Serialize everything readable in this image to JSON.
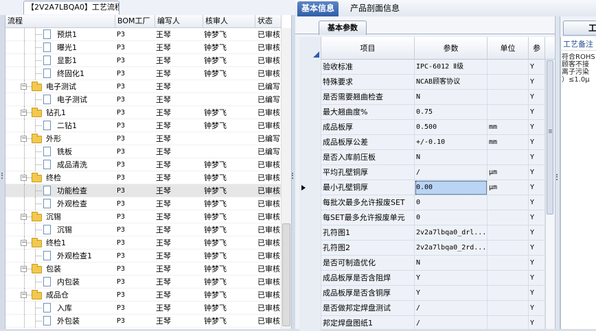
{
  "left_panel": {
    "tab_label": "【2V2A7LBQA0】工艺流程",
    "columns": [
      "流程",
      "BOM工厂",
      "编写人",
      "核审人",
      "状态"
    ],
    "rows": [
      {
        "level": 1,
        "type": "doc",
        "name": "预烘1",
        "bom": "P3",
        "author": "王琴",
        "reviewer": "钟梦飞",
        "status": "已审核"
      },
      {
        "level": 1,
        "type": "doc",
        "name": "曝光1",
        "bom": "P3",
        "author": "王琴",
        "reviewer": "钟梦飞",
        "status": "已审核"
      },
      {
        "level": 1,
        "type": "doc",
        "name": "显影1",
        "bom": "P3",
        "author": "王琴",
        "reviewer": "钟梦飞",
        "status": "已审核"
      },
      {
        "level": 1,
        "type": "doc",
        "name": "终固化1",
        "bom": "P3",
        "author": "王琴",
        "reviewer": "钟梦飞",
        "status": "已审核"
      },
      {
        "level": 0,
        "type": "folder",
        "name": "电子测试",
        "bom": "P3",
        "author": "王琴",
        "reviewer": "",
        "status": "已编写"
      },
      {
        "level": 1,
        "type": "doc",
        "name": "电子测试",
        "bom": "P3",
        "author": "王琴",
        "reviewer": "",
        "status": "已编写"
      },
      {
        "level": 0,
        "type": "folder",
        "name": "钻孔1",
        "bom": "P3",
        "author": "王琴",
        "reviewer": "钟梦飞",
        "status": "已审核"
      },
      {
        "level": 1,
        "type": "doc",
        "name": "二钻1",
        "bom": "P3",
        "author": "王琴",
        "reviewer": "钟梦飞",
        "status": "已审核"
      },
      {
        "level": 0,
        "type": "folder",
        "name": "外形",
        "bom": "P3",
        "author": "王琴",
        "reviewer": "",
        "status": "已编写"
      },
      {
        "level": 1,
        "type": "doc",
        "name": "铣板",
        "bom": "P3",
        "author": "王琴",
        "reviewer": "",
        "status": "已编写"
      },
      {
        "level": 1,
        "type": "doc",
        "name": "成品清洗",
        "bom": "P3",
        "author": "王琴",
        "reviewer": "钟梦飞",
        "status": "已审核"
      },
      {
        "level": 0,
        "type": "folder",
        "name": "终检",
        "bom": "P3",
        "author": "王琴",
        "reviewer": "钟梦飞",
        "status": "已审核"
      },
      {
        "level": 1,
        "type": "doc",
        "name": "功能检查",
        "bom": "P3",
        "author": "王琴",
        "reviewer": "钟梦飞",
        "status": "已审核",
        "selected": true
      },
      {
        "level": 1,
        "type": "doc",
        "name": "外观检查",
        "bom": "P3",
        "author": "王琴",
        "reviewer": "钟梦飞",
        "status": "已审核"
      },
      {
        "level": 0,
        "type": "folder",
        "name": "沉锡",
        "bom": "P3",
        "author": "王琴",
        "reviewer": "钟梦飞",
        "status": "已审核"
      },
      {
        "level": 1,
        "type": "doc",
        "name": "沉锡",
        "bom": "P3",
        "author": "王琴",
        "reviewer": "钟梦飞",
        "status": "已审核"
      },
      {
        "level": 0,
        "type": "folder",
        "name": "终检1",
        "bom": "P3",
        "author": "王琴",
        "reviewer": "钟梦飞",
        "status": "已审核"
      },
      {
        "level": 1,
        "type": "doc",
        "name": "外观检查1",
        "bom": "P3",
        "author": "王琴",
        "reviewer": "钟梦飞",
        "status": "已审核"
      },
      {
        "level": 0,
        "type": "folder",
        "name": "包装",
        "bom": "P3",
        "author": "王琴",
        "reviewer": "钟梦飞",
        "status": "已审核"
      },
      {
        "level": 1,
        "type": "doc",
        "name": "内包装",
        "bom": "P3",
        "author": "王琴",
        "reviewer": "钟梦飞",
        "status": "已审核"
      },
      {
        "level": 0,
        "type": "folder",
        "name": "成品仓",
        "bom": "P3",
        "author": "王琴",
        "reviewer": "钟梦飞",
        "status": "已审核"
      },
      {
        "level": 1,
        "type": "doc",
        "name": "入库",
        "bom": "P3",
        "author": "王琴",
        "reviewer": "钟梦飞",
        "status": "已审核"
      },
      {
        "level": 1,
        "type": "doc",
        "name": "外包装",
        "bom": "P3",
        "author": "王琴",
        "reviewer": "钟梦飞",
        "status": "已审核"
      }
    ]
  },
  "right_panel": {
    "tabs": [
      "基本信息",
      "产品剖面信息"
    ],
    "sub_tab": "基本参数",
    "columns": [
      "项目",
      "参数",
      "单位",
      "参"
    ],
    "rows": [
      {
        "item": "验收标准",
        "param": "IPC-6012 Ⅱ级",
        "unit": "",
        "flag": "Y"
      },
      {
        "item": "特殊要求",
        "param": "NCAB顾客协议",
        "unit": "",
        "flag": "Y"
      },
      {
        "item": "是否需要翘曲检查",
        "param": "N",
        "unit": "",
        "flag": "Y"
      },
      {
        "item": "最大翘曲度%",
        "param": "0.75",
        "unit": "",
        "flag": "Y"
      },
      {
        "item": "成品板厚",
        "param": "0.500",
        "unit": "mm",
        "flag": "Y"
      },
      {
        "item": "成品板厚公差",
        "param": "+/-0.10",
        "unit": "mm",
        "flag": "Y"
      },
      {
        "item": "是否入库前压板",
        "param": "N",
        "unit": "",
        "flag": "Y"
      },
      {
        "item": "平均孔壁铜厚",
        "param": "/",
        "unit": "μm",
        "flag": "Y"
      },
      {
        "item": "最小孔壁铜厚",
        "param": "0.00",
        "unit": "μm",
        "flag": "Y",
        "current": true
      },
      {
        "item": "每批次最多允许报废SET",
        "param": "0",
        "unit": "",
        "flag": "Y"
      },
      {
        "item": "每SET最多允许报废单元",
        "param": "0",
        "unit": "",
        "flag": "Y"
      },
      {
        "item": "孔符图1",
        "param": "2v2a7lbqa0_drl...",
        "unit": "",
        "flag": "Y"
      },
      {
        "item": "孔符图2",
        "param": "2v2a7lbqa0_2rd...",
        "unit": "",
        "flag": "Y"
      },
      {
        "item": "是否可制造优化",
        "param": "N",
        "unit": "",
        "flag": "Y"
      },
      {
        "item": "成品板厚是否含阻焊",
        "param": "Y",
        "unit": "",
        "flag": "Y"
      },
      {
        "item": "成品板厚是否含铜厚",
        "param": "Y",
        "unit": "",
        "flag": "Y"
      },
      {
        "item": "是否做邦定焊盘测试",
        "param": "/",
        "unit": "",
        "flag": "Y"
      },
      {
        "item": "邦定焊盘图纸1",
        "param": "/",
        "unit": "",
        "flag": "Y"
      }
    ],
    "side_tab": "工艺",
    "side_header": "工艺备注",
    "side_text": "符合ROHS\n顾客不接\n离子污染\n）≤1.0μ"
  },
  "colors": {
    "active_tab": "#2f5ea8",
    "selected_cell": "#b9d4f5",
    "side_header_text": "#2a4f8e"
  }
}
